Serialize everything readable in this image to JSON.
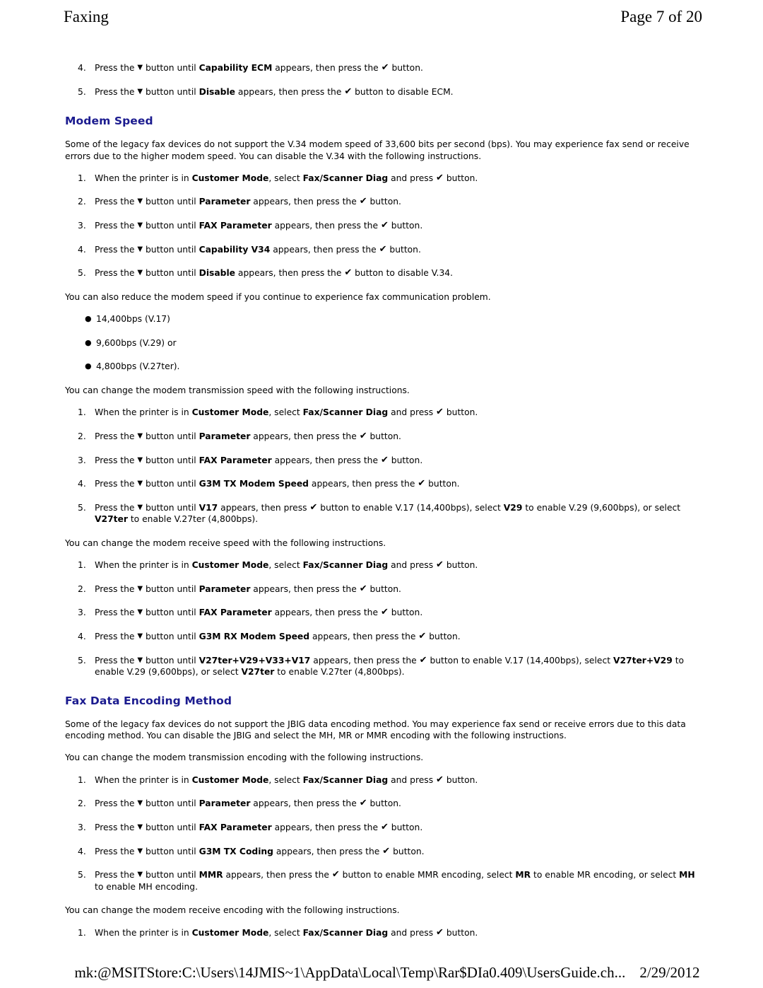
{
  "header": {
    "left": "Faxing",
    "right": "Page 7 of 20"
  },
  "footer": {
    "path": "mk:@MSITStore:C:\\Users\\14JMIS~1\\AppData\\Local\\Temp\\Rar$DIa0.409\\UsersGuide.ch...",
    "date": "2/29/2012"
  },
  "colors": {
    "heading": "#1b1b8f",
    "body": "#000000",
    "page_background": "#ffffff"
  },
  "icons": {
    "down_arrow": "▼",
    "check": "✔",
    "bullet": "●"
  },
  "top_steps": [
    {
      "num": "4.",
      "html": "Press the <span class=\"glyph-down\" data-name=\"down-arrow-icon\" data-interactable=\"false\">▼</span> button until <b>Capability ECM</b> appears, then press the <span class=\"glyph-check\" data-name=\"check-icon\" data-interactable=\"false\">✔</span> button."
    },
    {
      "num": "5.",
      "html": "Press the <span class=\"glyph-down\" data-name=\"down-arrow-icon\" data-interactable=\"false\">▼</span> button until <b>Disable</b> appears, then press the <span class=\"glyph-check\" data-name=\"check-icon\" data-interactable=\"false\">✔</span> button to disable ECM."
    }
  ],
  "sections": [
    {
      "id": "modem-speed",
      "heading": "Modem Speed",
      "intro": "Some of the legacy fax devices do not support the V.34 modem speed of 33,600 bits per second (bps). You may experience fax send or receive errors due to the higher modem speed. You can disable the V.34 with the following instructions.",
      "steps": [
        {
          "num": "1.",
          "html": "When the printer is in <b>Customer Mode</b>, select <b>Fax/Scanner Diag</b> and press <span class=\"glyph-check\" data-name=\"check-icon\" data-interactable=\"false\">✔</span> button."
        },
        {
          "num": "2.",
          "html": "Press the <span class=\"glyph-down\" data-name=\"down-arrow-icon\" data-interactable=\"false\">▼</span> button until <b>Parameter</b> appears, then press the <span class=\"glyph-check\" data-name=\"check-icon\" data-interactable=\"false\">✔</span> button."
        },
        {
          "num": "3.",
          "html": "Press the <span class=\"glyph-down\" data-name=\"down-arrow-icon\" data-interactable=\"false\">▼</span> button until <b>FAX Parameter</b> appears, then press the <span class=\"glyph-check\" data-name=\"check-icon\" data-interactable=\"false\">✔</span> button."
        },
        {
          "num": "4.",
          "html": "Press the <span class=\"glyph-down\" data-name=\"down-arrow-icon\" data-interactable=\"false\">▼</span> button until <b>Capability V34</b> appears, then press the <span class=\"glyph-check\" data-name=\"check-icon\" data-interactable=\"false\">✔</span> button."
        },
        {
          "num": "5.",
          "html": "Press the <span class=\"glyph-down\" data-name=\"down-arrow-icon\" data-interactable=\"false\">▼</span> button until <b>Disable</b> appears, then press the <span class=\"glyph-check\" data-name=\"check-icon\" data-interactable=\"false\">✔</span> button to disable V.34."
        }
      ],
      "reduce_note": "You can also reduce the modem speed if you continue to experience fax communication problem.",
      "speed_bullets": [
        "14,400bps (V.17)",
        "9,600bps (V.29) or",
        "4,800bps (V.27ter)."
      ],
      "tx_note": "You can change the modem transmission speed with the following instructions.",
      "tx_steps": [
        {
          "num": "1.",
          "html": "When the printer is in <b>Customer Mode</b>, select <b>Fax/Scanner Diag</b> and press <span class=\"glyph-check\" data-name=\"check-icon\" data-interactable=\"false\">✔</span> button."
        },
        {
          "num": "2.",
          "html": "Press the <span class=\"glyph-down\" data-name=\"down-arrow-icon\" data-interactable=\"false\">▼</span> button until <b>Parameter</b> appears, then press the <span class=\"glyph-check\" data-name=\"check-icon\" data-interactable=\"false\">✔</span> button."
        },
        {
          "num": "3.",
          "html": "Press the <span class=\"glyph-down\" data-name=\"down-arrow-icon\" data-interactable=\"false\">▼</span> button until <b>FAX Parameter</b> appears, then press the <span class=\"glyph-check\" data-name=\"check-icon\" data-interactable=\"false\">✔</span> button."
        },
        {
          "num": "4.",
          "html": "Press the <span class=\"glyph-down\" data-name=\"down-arrow-icon\" data-interactable=\"false\">▼</span> button until <b>G3M TX Modem Speed</b> appears, then press the <span class=\"glyph-check\" data-name=\"check-icon\" data-interactable=\"false\">✔</span> button."
        },
        {
          "num": "5.",
          "html": "Press the <span class=\"glyph-down\" data-name=\"down-arrow-icon\" data-interactable=\"false\">▼</span> button until <b>V17</b> appears, then press <span class=\"glyph-check\" data-name=\"check-icon\" data-interactable=\"false\">✔</span> button to enable V.17 (14,400bps), select <b>V29</b> to enable V.29 (9,600bps), or select <b>V27ter</b> to enable V.27ter (4,800bps)."
        }
      ],
      "rx_note": "You can change the modem receive speed with the following instructions.",
      "rx_steps": [
        {
          "num": "1.",
          "html": "When the printer is in <b>Customer Mode</b>, select <b>Fax/Scanner Diag</b> and press <span class=\"glyph-check\" data-name=\"check-icon\" data-interactable=\"false\">✔</span> button."
        },
        {
          "num": "2.",
          "html": "Press the <span class=\"glyph-down\" data-name=\"down-arrow-icon\" data-interactable=\"false\">▼</span> button until <b>Parameter</b> appears, then press the <span class=\"glyph-check\" data-name=\"check-icon\" data-interactable=\"false\">✔</span> button."
        },
        {
          "num": "3.",
          "html": "Press the <span class=\"glyph-down\" data-name=\"down-arrow-icon\" data-interactable=\"false\">▼</span> button until <b>FAX Parameter</b> appears, then press the <span class=\"glyph-check\" data-name=\"check-icon\" data-interactable=\"false\">✔</span> button."
        },
        {
          "num": "4.",
          "html": "Press the <span class=\"glyph-down\" data-name=\"down-arrow-icon\" data-interactable=\"false\">▼</span> button until <b>G3M RX Modem Speed</b> appears, then press the <span class=\"glyph-check\" data-name=\"check-icon\" data-interactable=\"false\">✔</span> button."
        },
        {
          "num": "5.",
          "html": "Press the <span class=\"glyph-down\" data-name=\"down-arrow-icon\" data-interactable=\"false\">▼</span> button until <b>V27ter+V29+V33+V17</b> appears, then press the <span class=\"glyph-check\" data-name=\"check-icon\" data-interactable=\"false\">✔</span> button to enable V.17 (14,400bps), select <b>V27ter+V29</b> to enable V.29 (9,600bps), or select <b>V27ter</b> to enable V.27ter (4,800bps)."
        }
      ]
    },
    {
      "id": "fax-data-encoding-method",
      "heading": "Fax Data Encoding Method",
      "intro": "Some of the legacy fax devices do not support the JBIG data encoding method. You may experience fax send or receive errors due to this data encoding method. You can disable the JBIG and select the MH, MR or MMR encoding with the following instructions.",
      "tx_note": "You can change the modem transmission encoding with the following instructions.",
      "tx_steps": [
        {
          "num": "1.",
          "html": "When the printer is in <b>Customer Mode</b>, select <b>Fax/Scanner Diag</b> and press <span class=\"glyph-check\" data-name=\"check-icon\" data-interactable=\"false\">✔</span> button."
        },
        {
          "num": "2.",
          "html": "Press the <span class=\"glyph-down\" data-name=\"down-arrow-icon\" data-interactable=\"false\">▼</span> button until <b>Parameter</b> appears, then press the <span class=\"glyph-check\" data-name=\"check-icon\" data-interactable=\"false\">✔</span> button."
        },
        {
          "num": "3.",
          "html": "Press the <span class=\"glyph-down\" data-name=\"down-arrow-icon\" data-interactable=\"false\">▼</span> button until <b>FAX Parameter</b> appears, then press the <span class=\"glyph-check\" data-name=\"check-icon\" data-interactable=\"false\">✔</span> button."
        },
        {
          "num": "4.",
          "html": "Press the <span class=\"glyph-down\" data-name=\"down-arrow-icon\" data-interactable=\"false\">▼</span> button until <b>G3M TX Coding</b> appears, then press the <span class=\"glyph-check\" data-name=\"check-icon\" data-interactable=\"false\">✔</span> button."
        },
        {
          "num": "5.",
          "html": "Press the <span class=\"glyph-down\" data-name=\"down-arrow-icon\" data-interactable=\"false\">▼</span> button until <b>MMR</b> appears, then press the <span class=\"glyph-check\" data-name=\"check-icon\" data-interactable=\"false\">✔</span> button to enable MMR encoding, select <b>MR</b> to enable MR encoding, or select <b>MH</b> to enable MH encoding."
        }
      ],
      "rx_note": "You can change the modem receive encoding with the following instructions.",
      "rx_steps": [
        {
          "num": "1.",
          "html": "When the printer is in <b>Customer Mode</b>, select <b>Fax/Scanner Diag</b> and press <span class=\"glyph-check\" data-name=\"check-icon\" data-interactable=\"false\">✔</span> button."
        }
      ]
    }
  ]
}
